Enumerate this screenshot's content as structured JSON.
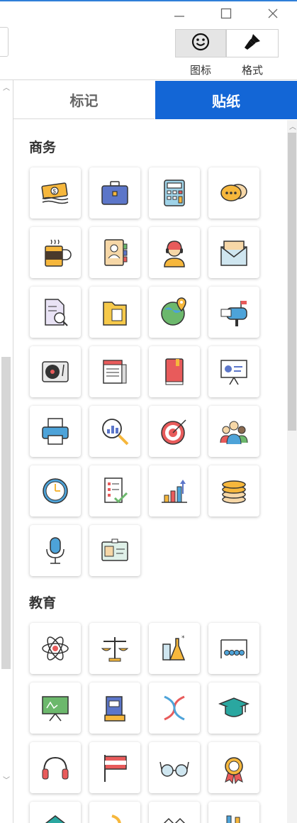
{
  "window": {
    "minimize_icon": "minimize-icon",
    "maximize_icon": "maximize-icon",
    "close_icon": "close-icon"
  },
  "toolbar": {
    "icon_tab_label": "图标",
    "format_tab_label": "格式",
    "icon_tab_icon": "smiley-icon",
    "format_tab_icon": "brush-icon"
  },
  "tabs": [
    {
      "label": "标记",
      "active": false
    },
    {
      "label": "贴纸",
      "active": true
    }
  ],
  "sections": [
    {
      "title": "商务",
      "stickers": [
        "money-icon",
        "briefcase-icon",
        "calculator-icon",
        "chat-bubbles-icon",
        "coffee-mug-icon",
        "contact-book-icon",
        "customer-service-icon",
        "envelope-icon",
        "document-search-icon",
        "folder-icon",
        "globe-location-icon",
        "mailbox-icon",
        "turntable-icon",
        "newspaper-icon",
        "book-icon",
        "presentation-board-icon",
        "printer-icon",
        "magnifier-chart-icon",
        "target-icon",
        "team-icon",
        "clock-icon",
        "checklist-icon",
        "bar-chart-icon",
        "coins-icon",
        "microphone-icon",
        "id-card-icon"
      ]
    },
    {
      "title": "教育",
      "stickers": [
        "atom-icon",
        "scales-icon",
        "lab-flasks-icon",
        "newtons-cradle-icon",
        "chalkboard-icon",
        "books-icon",
        "dna-icon",
        "graduation-cap-icon",
        "headphones-icon",
        "flag-icon",
        "glasses-icon",
        "medal-icon",
        "house-icon",
        "crescent-icon",
        "laptop-icon",
        "pencil-cup-icon"
      ]
    }
  ],
  "colors": {
    "accent": "#1366d6",
    "tab_active_text": "#ffffff"
  }
}
